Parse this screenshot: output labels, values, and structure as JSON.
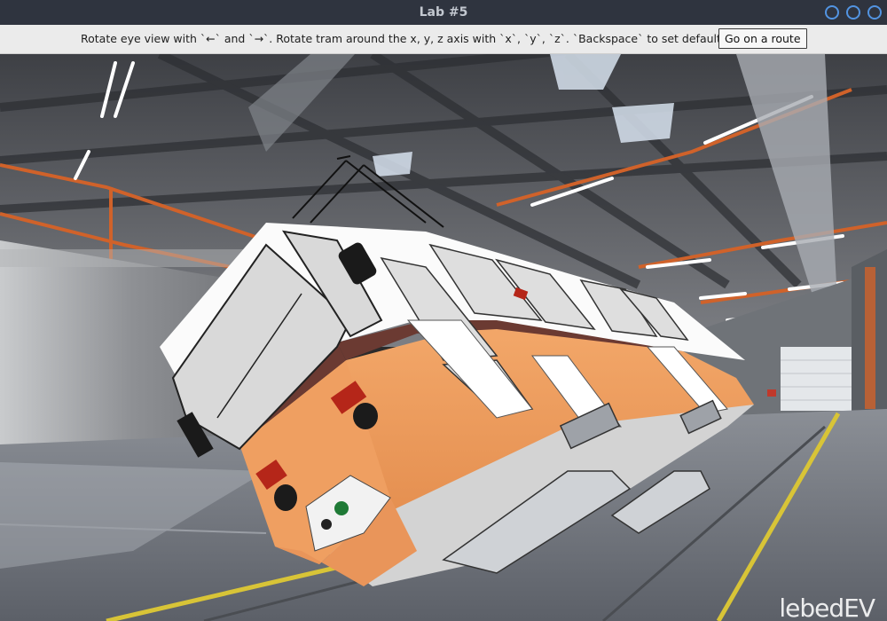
{
  "window": {
    "title": "Lab #5"
  },
  "toolbar": {
    "hint": "Rotate eye view with `←` and `→`. Rotate tram around the x, y, z axis with `x`, `y`, `z`. `Backspace` to set default",
    "route_button": "Go on a route"
  },
  "scene": {
    "watermark": "lebedEV"
  },
  "colors": {
    "titlebar": "#2f343f",
    "wm_button": "#5294e2",
    "tram_body": "#f0a062",
    "tram_roof": "#ffffff",
    "tram_stripe": "#6b3a32",
    "floor_line": "#d8c437"
  }
}
